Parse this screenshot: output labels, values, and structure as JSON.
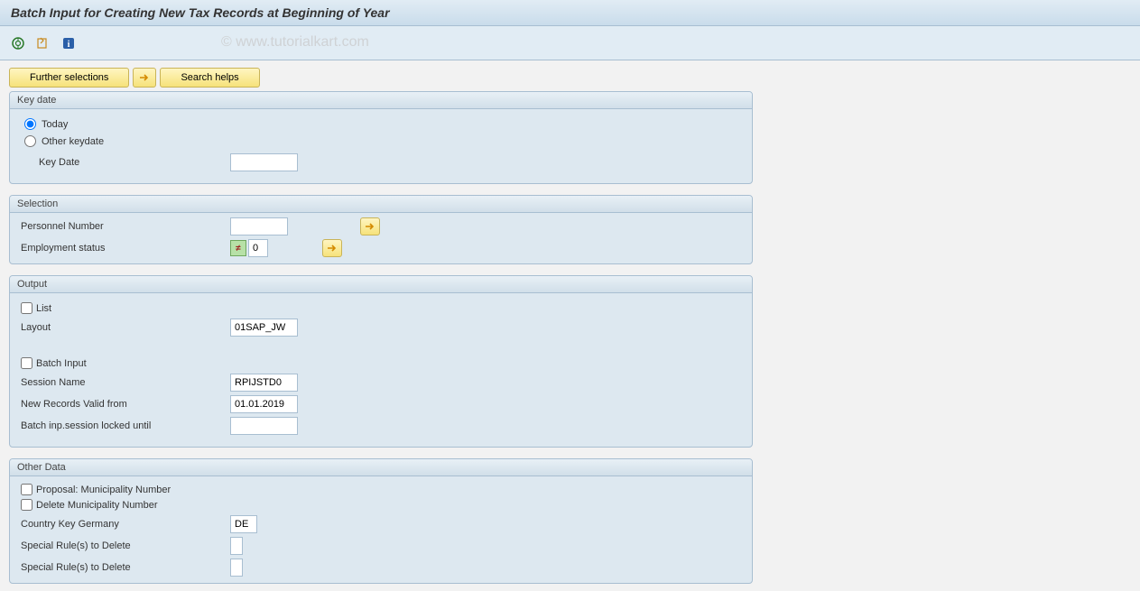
{
  "title": "Batch Input for Creating New Tax Records at Beginning of Year",
  "watermark": "© www.tutorialkart.com",
  "toolbar_buttons": {
    "further_selections": "Further selections",
    "search_helps": "Search helps"
  },
  "group_keydate": {
    "title": "Key date",
    "radio_today": "Today",
    "radio_other": "Other keydate",
    "label_keydate": "Key Date",
    "value_keydate": ""
  },
  "group_selection": {
    "title": "Selection",
    "label_personnel": "Personnel Number",
    "value_personnel": "",
    "label_employment": "Employment status",
    "value_employment": "0",
    "ne_symbol": "≠"
  },
  "group_output": {
    "title": "Output",
    "check_list": "List",
    "label_layout": "Layout",
    "value_layout": "01SAP_JW",
    "check_batch": "Batch Input",
    "label_session": "Session Name",
    "value_session": "RPIJSTD0",
    "label_validfrom": "New Records Valid from",
    "value_validfrom": "01.01.2019",
    "label_locked": "Batch inp.session locked until",
    "value_locked": ""
  },
  "group_other": {
    "title": "Other Data",
    "check_proposal": "Proposal: Municipality Number",
    "check_delete": "Delete Municipality Number",
    "label_country": "Country Key Germany",
    "value_country": "DE",
    "label_special1": "Special Rule(s) to Delete",
    "value_special1": "",
    "label_special2": "Special Rule(s) to Delete",
    "value_special2": ""
  }
}
